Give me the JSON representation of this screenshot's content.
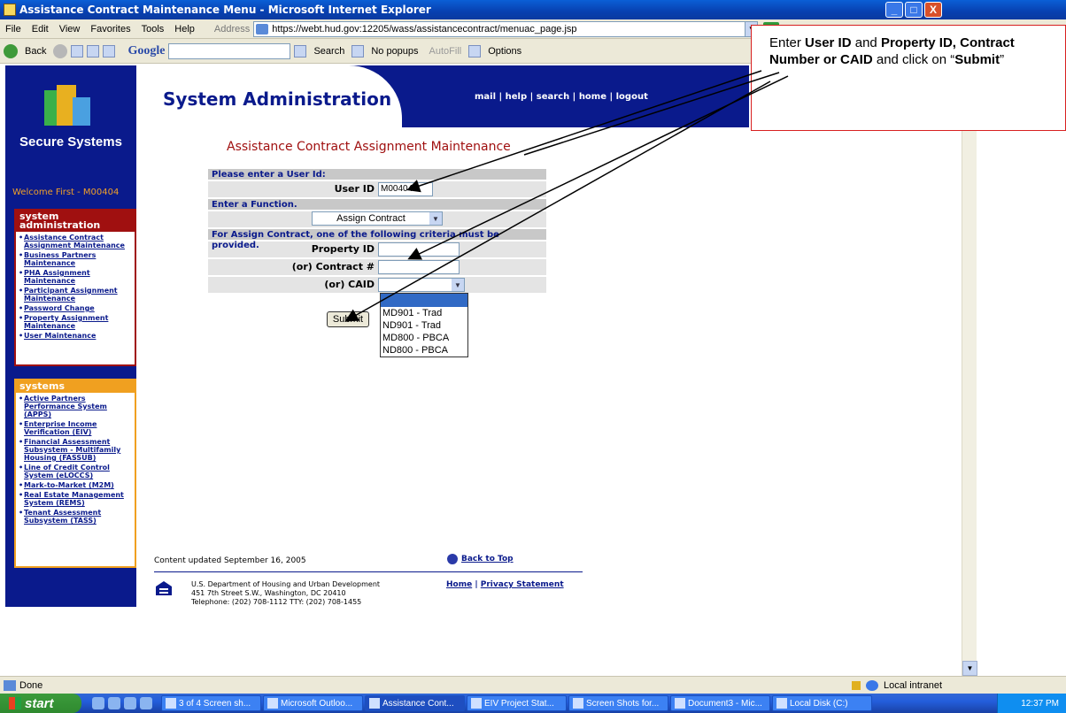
{
  "window": {
    "title": "Assistance Contract Maintenance Menu - Microsoft Internet Explorer",
    "minimize": "_",
    "maximize": "□",
    "close": "X"
  },
  "menubar": {
    "items": [
      "File",
      "Edit",
      "View",
      "Favorites",
      "Tools",
      "Help"
    ],
    "address_label": "Address",
    "url": "https://webt.hud.gov:12205/wass/assistancecontract/menuac_page.jsp",
    "go_label": "Go"
  },
  "toolbar": {
    "back": "Back",
    "google": "Google",
    "search": "Search",
    "popups": "No popups",
    "autofill": "AutoFill",
    "options": "Options"
  },
  "sidebar": {
    "brand": "Secure Systems",
    "welcome": "Welcome First - M00404",
    "sysadmin_title": "system administration",
    "sysadmin_items": [
      "Assistance Contract Assignment Maintenance",
      "Business Partners Maintenance",
      "PHA Assignment Maintenance",
      "Participant Assignment Maintenance",
      "Password Change",
      "Property Assignment Maintenance",
      "User Maintenance"
    ],
    "systems_title": "systems",
    "systems_items": [
      "Active Partners Performance System (APPS)",
      "Enterprise Income Verification (EIV)",
      "Financial Assessment Subsystem - Multifamily Housing (FASSUB)",
      "Line of Credit Control System (eLOCCS)",
      "Mark-to-Market (M2M)",
      "Real Estate Management System (REMS)",
      "Tenant Assessment Subsystem (TASS)"
    ]
  },
  "header": {
    "title": "System Administration",
    "links": "mail | help | search | home | logout"
  },
  "main": {
    "heading": "Assistance Contract Assignment Maintenance",
    "sec_user": "Please enter a User Id:",
    "user_label": "User ID",
    "user_value": "M00404",
    "sec_function": "Enter a Function.",
    "function_value": "Assign Contract",
    "sec_criteria": "For Assign Contract, one of the following criteria must be provided.",
    "property_label": "Property ID",
    "contract_label": "(or)  Contract #",
    "caid_label": "(or)  CAID",
    "submit_label": "Submit",
    "caid_options": [
      "",
      "MD901 - Trad",
      "ND901 - Trad",
      "MD800 - PBCA",
      "ND800 - PBCA"
    ]
  },
  "footer": {
    "updated": "Content updated September 16, 2005",
    "back_top": "Back to Top",
    "addr1": "U.S. Department of Housing and Urban Development",
    "addr2": "451 7th Street S.W., Washington, DC 20410",
    "addr3": "Telephone: (202) 708-1112 TTY: (202) 708-1455",
    "home": "Home",
    "privacy": "Privacy Statement"
  },
  "status": {
    "left": "Done",
    "right": "Local intranet"
  },
  "taskbar": {
    "start": "start",
    "tasks": [
      "3 of 4 Screen sh...",
      "Microsoft Outloo...",
      "Assistance Cont...",
      "EIV Project Stat...",
      "Screen Shots for...",
      "Document3 - Mic...",
      "Local Disk (C:)"
    ],
    "clock": "12:37 PM"
  },
  "callout": {
    "t1": "Enter ",
    "t2": "User ID",
    "t3": " and ",
    "t4": "Property ID, Contract Number or CAID",
    "t5": " and click on “",
    "t6": "Submit",
    "t7": "”"
  }
}
